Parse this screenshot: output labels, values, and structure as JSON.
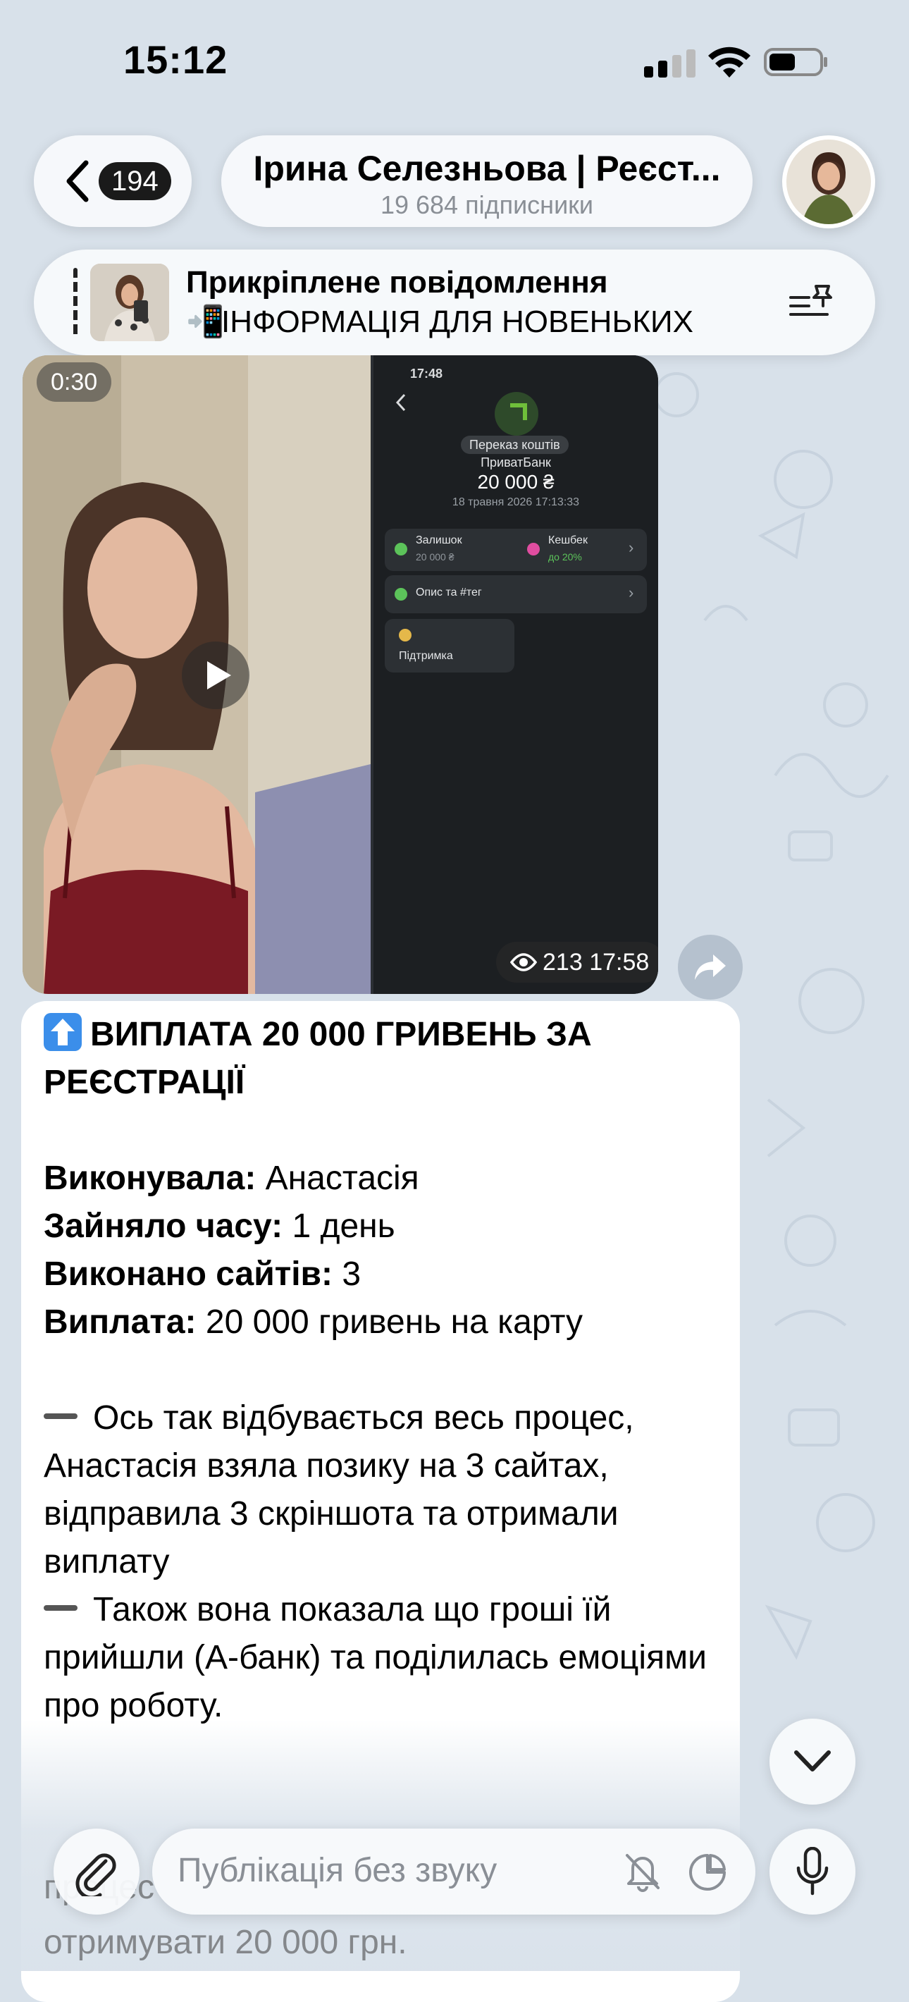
{
  "status_bar": {
    "time": "15:12"
  },
  "header": {
    "back_count": "194",
    "channel_title": "Ірина Селезньова | Реєст...",
    "subscribers": "19 684 підписники"
  },
  "pinned": {
    "title": "Прикріплене повідомлення",
    "text": "ІНФОРМАЦІЯ ДЛЯ НОВЕНЬКИХ",
    "emoji": "📲"
  },
  "media": {
    "duration": "0:30",
    "views": "213",
    "time": "17:58",
    "screenshot": {
      "time": "17:48",
      "transfer_label": "Переказ коштів",
      "bank": "ПриватБанк",
      "amount": "20 000 ₴",
      "date": "18 травня 2026 17:13:33",
      "balance_label": "Залишок",
      "balance_value": "20 000 ₴",
      "cashback_label": "Кешбек",
      "cashback_value": "до 20%",
      "description_label": "Опис та #тег",
      "support_label": "Підтримка"
    }
  },
  "message": {
    "headline": "ВИПЛАТА 20 000 ГРИВЕНЬ ЗА РЕЄСТРАЦІЇ",
    "performer_label": "Виконувала:",
    "performer_value": "Анастасія",
    "time_label": "Зайняло часу:",
    "time_value": "1 день",
    "sites_label": "Виконано сайтів:",
    "sites_value": "3",
    "payout_label": "Виплата:",
    "payout_value": "20 000 гривень на карту",
    "para1": "Ось так відбувається весь процес, Анастасія взяла позику на 3 сайтах, відправила 3 скріншота та отримали виплату",
    "para2": "Також вона показала що гроші їй прийшли (А-банк) та поділилась емоціями про роботу.",
    "partial_line2": "процес",
    "partial_line3": "отримувати 20 000 грн."
  },
  "composer": {
    "placeholder": "Публікація без звуку"
  },
  "colors": {
    "background": "#d8e1ea",
    "bubble": "#ffffff",
    "accent_green": "#5cc35a"
  }
}
